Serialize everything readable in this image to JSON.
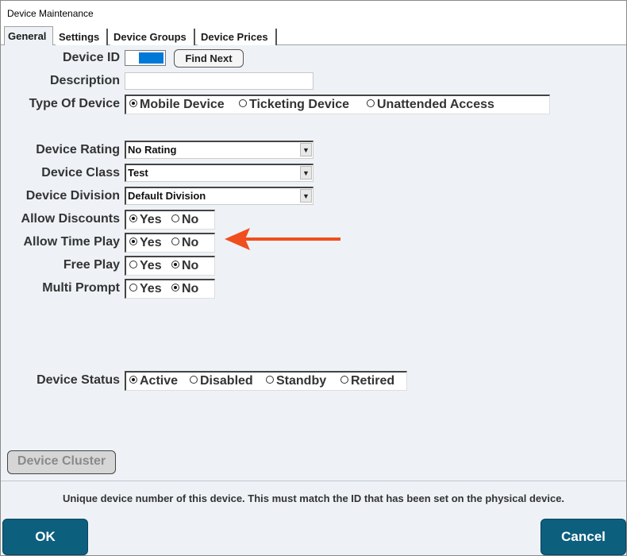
{
  "window": {
    "title": "Device Maintenance"
  },
  "tabs": [
    "General",
    "Settings",
    "Device Groups",
    "Device Prices"
  ],
  "form": {
    "device_id": {
      "label": "Device ID",
      "find_next": "Find Next"
    },
    "description": {
      "label": "Description",
      "value": ""
    },
    "type_of_device": {
      "label": "Type Of Device",
      "options": [
        "Mobile Device",
        "Ticketing Device",
        "Unattended Access"
      ],
      "selected": "Mobile Device"
    },
    "device_rating": {
      "label": "Device Rating",
      "value": "No Rating"
    },
    "device_class": {
      "label": "Device Class",
      "value": "Test"
    },
    "device_division": {
      "label": "Device Division",
      "value": "Default Division"
    },
    "allow_discounts": {
      "label": "Allow Discounts",
      "yes": "Yes",
      "no": "No",
      "selected": "Yes"
    },
    "allow_time_play": {
      "label": "Allow Time Play",
      "yes": "Yes",
      "no": "No",
      "selected": "Yes"
    },
    "free_play": {
      "label": "Free Play",
      "yes": "Yes",
      "no": "No",
      "selected": "No"
    },
    "multi_prompt": {
      "label": "Multi Prompt",
      "yes": "Yes",
      "no": "No",
      "selected": "No"
    },
    "device_status": {
      "label": "Device Status",
      "options": [
        "Active",
        "Disabled",
        "Standby",
        "Retired"
      ],
      "selected": "Active"
    },
    "device_cluster": "Device Cluster"
  },
  "hint": "Unique device number of this device.  This must match the ID that has been set on the physical device.",
  "buttons": {
    "ok": "OK",
    "cancel": "Cancel"
  },
  "colors": {
    "accent_button": "#0d5f7e",
    "selection": "#0078d7",
    "annotation_arrow": "#f04e1f"
  },
  "annotation": {
    "icon": "arrow-left-icon",
    "points_to": "allow_time_play"
  }
}
